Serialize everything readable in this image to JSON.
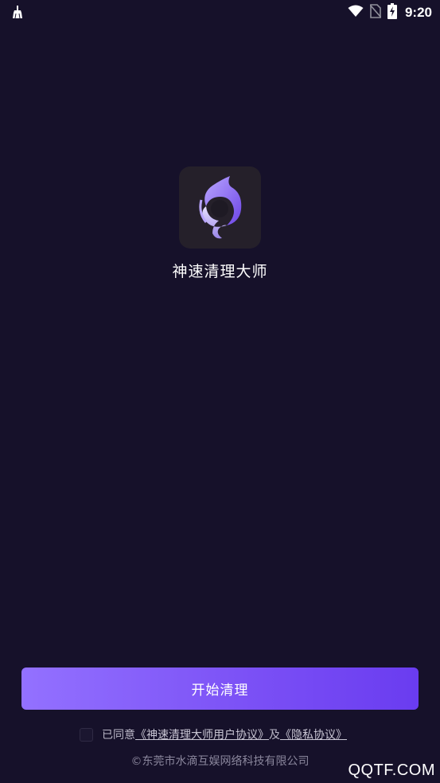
{
  "status_bar": {
    "time": "9:20",
    "left_icon": "broom-notification-icon",
    "icons": [
      "wifi-icon",
      "no-sim-icon",
      "battery-charging-icon"
    ]
  },
  "app": {
    "name": "神速清理大师",
    "icon": "swirl-logo-icon"
  },
  "actions": {
    "start_label": "开始清理"
  },
  "agreement": {
    "prefix": "已同意",
    "user_agreement": "《神速清理大师用户协议》",
    "connector": "及",
    "privacy_policy": "《隐私协议》",
    "checked": false
  },
  "footer": {
    "copyright": "©东莞市水滴互娱网络科技有限公司"
  },
  "watermark": {
    "text": "QQTF.COM"
  },
  "colors": {
    "background": "#16112a",
    "button_start": "#9371ff",
    "button_end": "#6a3cf0",
    "icon_tile": "#25202a"
  }
}
